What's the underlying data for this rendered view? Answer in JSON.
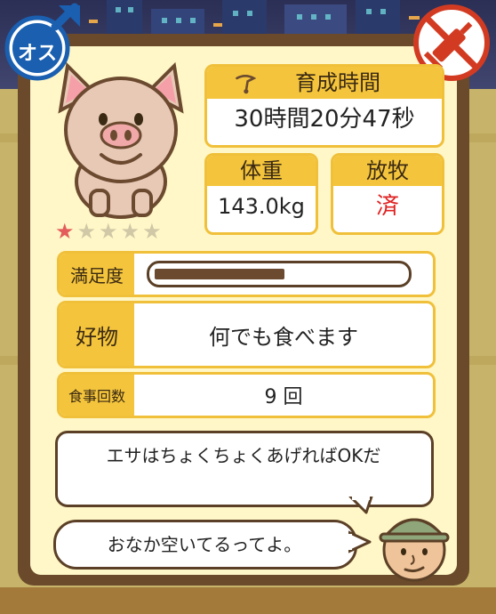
{
  "badges": {
    "gender": "オス",
    "gender_icon": "male-symbol",
    "no_medicine_icon": "no-syringe"
  },
  "pig": {
    "rating": 1,
    "rating_max": 5
  },
  "time": {
    "label": "育成時間",
    "value": "30時間20分47秒"
  },
  "weight": {
    "label": "体重",
    "value": "143.0kg"
  },
  "grazing": {
    "label": "放牧",
    "value": "済"
  },
  "satisfaction": {
    "label": "満足度",
    "level_fraction": 0.52
  },
  "favorite": {
    "label": "好物",
    "value": "何でも食べます"
  },
  "meals": {
    "label": "食事回数",
    "value": "9 回"
  },
  "speech": {
    "line1": "エサはちょくちょくあげればOKだ",
    "line2": "おなか空いてるってよ。"
  },
  "colors": {
    "accent": "#f4c53c",
    "frame": "#6a4a2a",
    "card": "#fff7c7",
    "done": "#e02020",
    "star_on": "#e35b5b"
  }
}
